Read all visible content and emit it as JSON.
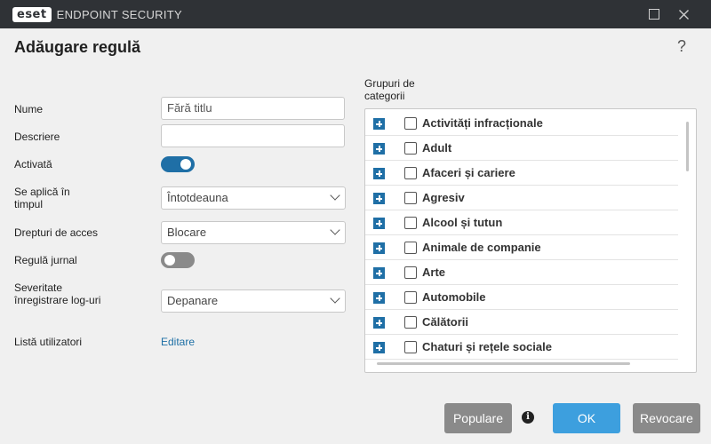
{
  "window": {
    "logo_text": "eset",
    "product_name": "ENDPOINT SECURITY",
    "maximize_icon": "maximize-icon",
    "close_icon": "close-icon"
  },
  "header": {
    "title": "Adăugare regulă",
    "help_glyph": "?"
  },
  "form": {
    "name_label": "Nume",
    "name_value": "Fără titlu",
    "description_label": "Descriere",
    "description_value": "",
    "enabled_label": "Activată",
    "enabled": true,
    "applies_label": "Se aplică în timpul",
    "applies_value": "Întotdeauna",
    "access_label": "Drepturi de acces",
    "access_value": "Blocare",
    "log_rule_label": "Regulă jurnal",
    "log_rule": false,
    "severity_label": "Severitate înregistrare log-uri",
    "severity_value": "Depanare",
    "users_label": "Listă utilizatori",
    "users_link": "Editare"
  },
  "groups": {
    "label": "Grupuri de categorii",
    "items": [
      {
        "label": "Activități infracționale",
        "checked": false
      },
      {
        "label": "Adult",
        "checked": false
      },
      {
        "label": "Afaceri și cariere",
        "checked": false
      },
      {
        "label": "Agresiv",
        "checked": false
      },
      {
        "label": "Alcool și tutun",
        "checked": false
      },
      {
        "label": "Animale de companie",
        "checked": false
      },
      {
        "label": "Arte",
        "checked": false
      },
      {
        "label": "Automobile",
        "checked": false
      },
      {
        "label": "Călătorii",
        "checked": false
      },
      {
        "label": "Chaturi și rețele sociale",
        "checked": false
      }
    ]
  },
  "footer": {
    "populate_label": "Populare",
    "ok_label": "OK",
    "cancel_label": "Revocare",
    "info_glyph": "i"
  },
  "colors": {
    "titlebar": "#2f3236",
    "accent": "#1f6fa6",
    "ok_button": "#3d9fde",
    "grey_button": "#8a8a8a"
  }
}
